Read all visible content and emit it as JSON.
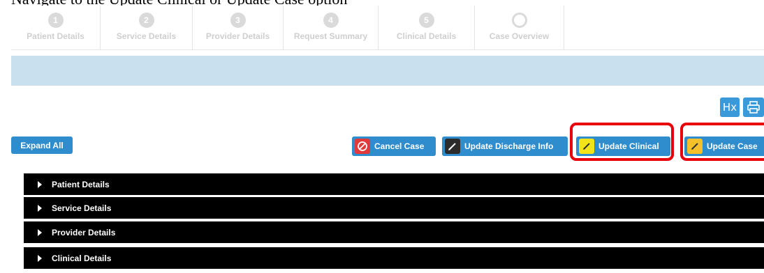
{
  "caption": "Navigate to the Update Clinical or Update Case option",
  "steps": [
    {
      "number": "1",
      "label": "Patient Details"
    },
    {
      "number": "2",
      "label": "Service Details"
    },
    {
      "number": "3",
      "label": "Provider Details"
    },
    {
      "number": "4",
      "label": "Request Summary"
    },
    {
      "number": "5",
      "label": "Clinical Details"
    },
    {
      "number": "",
      "label": "Case Overview"
    }
  ],
  "toolbar": {
    "history_label": "Hx",
    "expand_all": "Expand All",
    "cancel_case": "Cancel Case",
    "update_discharge": "Update Discharge Info",
    "update_clinical": "Update Clinical",
    "update_case": "Update Case"
  },
  "sections": [
    {
      "label": "Patient Details"
    },
    {
      "label": "Service Details"
    },
    {
      "label": "Provider Details"
    },
    {
      "label": "Clinical Details"
    }
  ],
  "colors": {
    "highlight": "#e8000b",
    "button_blue": "#2f8ccd",
    "cancel_icon": "#e23a3a",
    "edit_icon_yellow": "#f3e41a",
    "edit_icon_orange": "#f4c12a",
    "band": "#c9e0ef"
  }
}
